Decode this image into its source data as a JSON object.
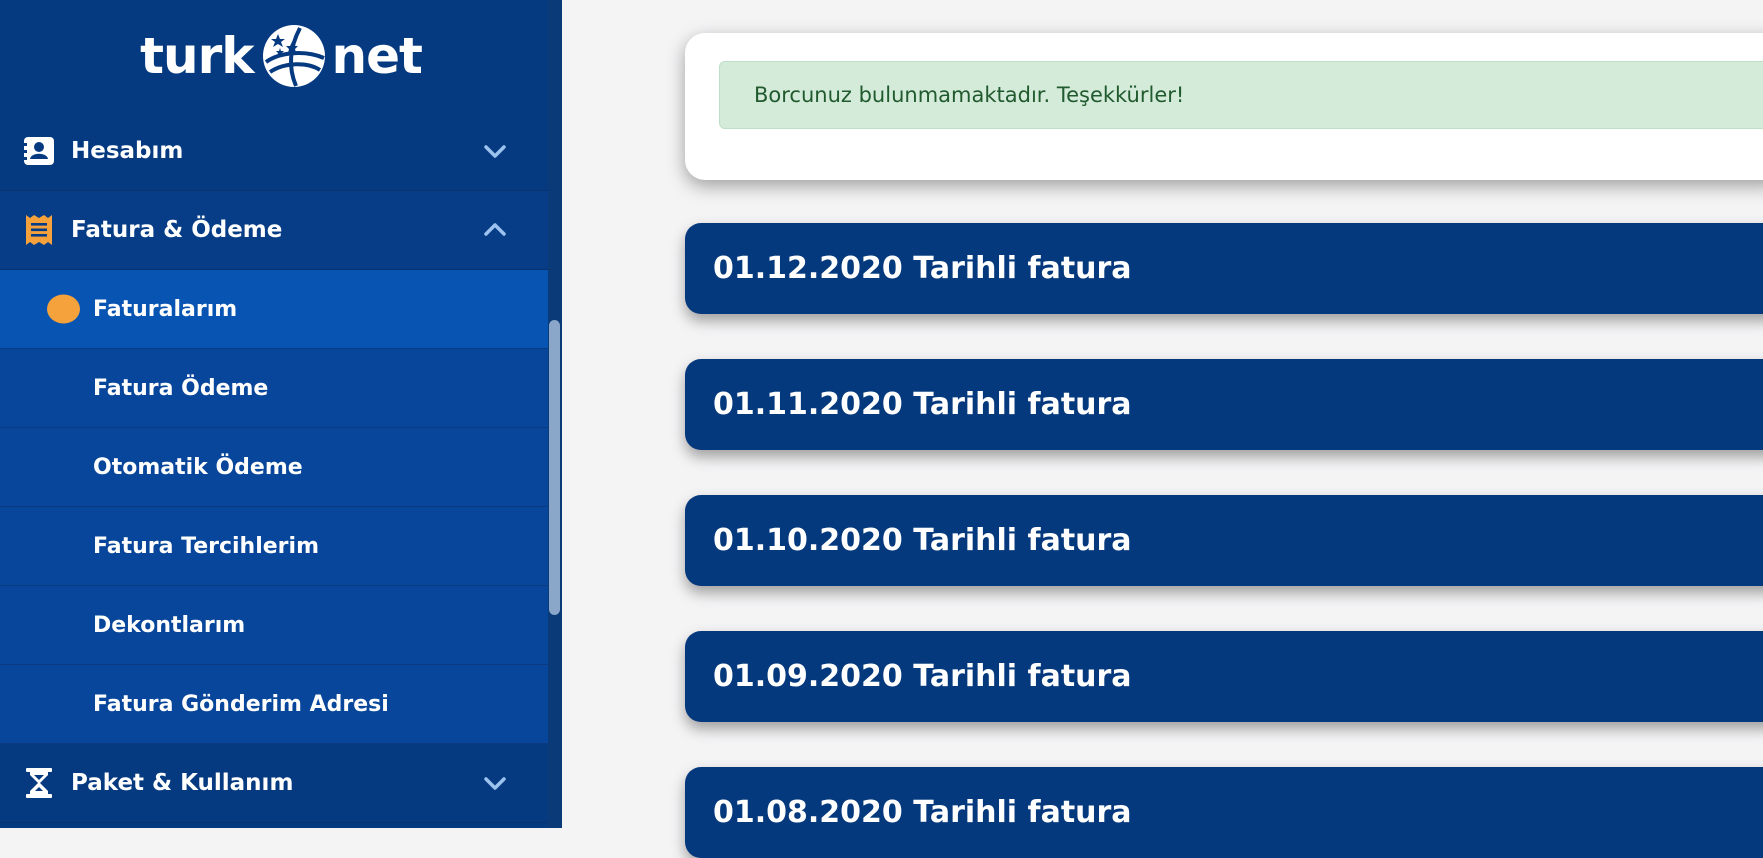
{
  "brand": {
    "logo_left": "turk",
    "logo_right": "net"
  },
  "sidebar": {
    "groups": [
      {
        "label": "Hesabım",
        "icon": "contact-card-icon",
        "expanded": false
      },
      {
        "label": "Fatura & Ödeme",
        "icon": "receipt-icon",
        "expanded": true,
        "items": [
          {
            "label": "Faturalarım",
            "active": true
          },
          {
            "label": "Fatura Ödeme",
            "active": false
          },
          {
            "label": "Otomatik Ödeme",
            "active": false
          },
          {
            "label": "Fatura Tercihlerim",
            "active": false
          },
          {
            "label": "Dekontlarım",
            "active": false
          },
          {
            "label": "Fatura Gönderim Adresi",
            "active": false
          }
        ]
      },
      {
        "label": "Paket & Kullanım",
        "icon": "hourglass-icon",
        "expanded": false
      }
    ]
  },
  "main": {
    "alert_message": "Borcunuz bulunmamaktadır. Teşekkürler!",
    "invoices": [
      {
        "title": "01.12.2020 Tarihli fatura"
      },
      {
        "title": "01.11.2020 Tarihli fatura"
      },
      {
        "title": "01.10.2020 Tarihli fatura"
      },
      {
        "title": "01.09.2020 Tarihli fatura"
      },
      {
        "title": "01.08.2020 Tarihli fatura"
      }
    ]
  },
  "colors": {
    "sidebar_bg": "#063a80",
    "submenu_bg": "#07469a",
    "active_bg": "#0754b2",
    "accent_orange": "#f5a23c",
    "invoice_bg": "#05397d",
    "alert_bg": "#d4ebd9",
    "alert_text": "#205a2e"
  }
}
